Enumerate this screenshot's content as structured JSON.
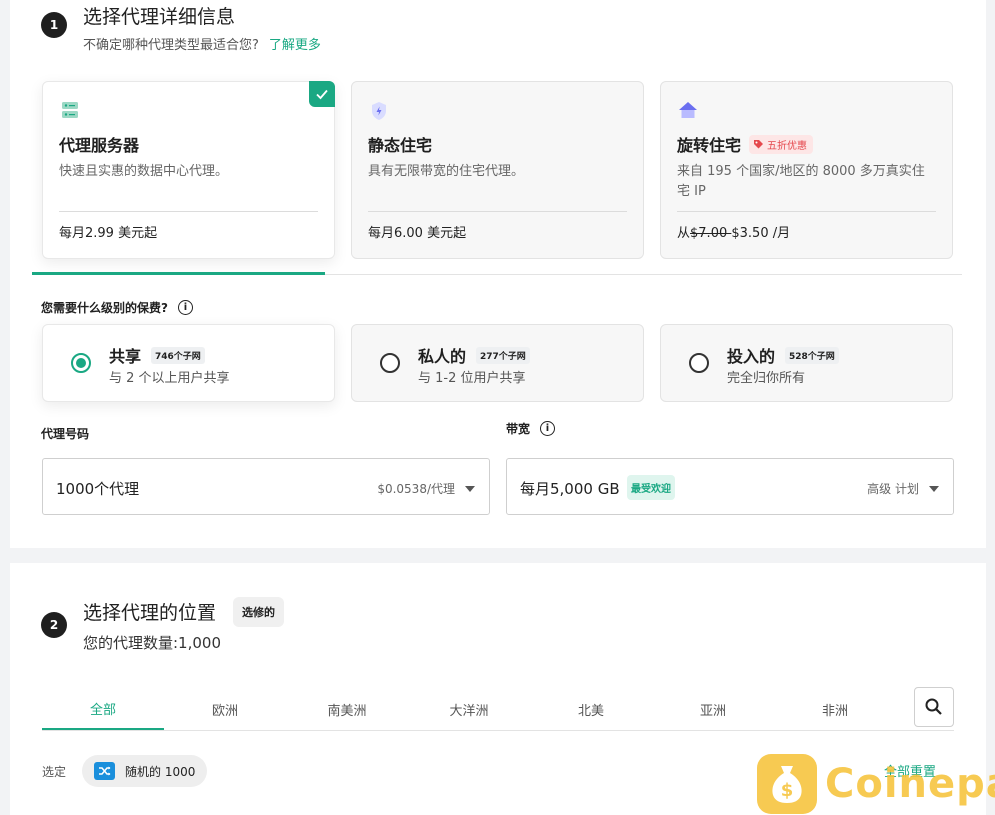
{
  "step1": {
    "number": "1",
    "title": "选择代理详细信息",
    "subtitle": "不确定哪种代理类型最适合您?",
    "learn_more": "了解更多"
  },
  "proxy_types": [
    {
      "name": "代理服务器",
      "desc": "快速且实惠的数据中心代理。",
      "price": "每月2.99 美元起",
      "selected": true,
      "icon": "server-icon"
    },
    {
      "name": "静态住宅",
      "desc": "具有无限带宽的住宅代理。",
      "price": "每月6.00 美元起",
      "selected": false,
      "icon": "shield-icon"
    },
    {
      "name": "旋转住宅",
      "badge": "五折优惠",
      "desc": "来自 195 个国家/地区的 8000 多万真实住宅 IP",
      "price_prefix": "从",
      "price_old": "$7.00 ",
      "price_new": " $3.50 /月",
      "selected": false,
      "icon": "house-icon"
    }
  ],
  "privacy_question": "您需要什么级别的保费?",
  "tiers": [
    {
      "name": "共享",
      "count": "746个子网",
      "desc": "与 2 个以上用户共享",
      "selected": true
    },
    {
      "name": "私人的",
      "count": "277个子网",
      "desc": "与 1-2 位用户共享",
      "selected": false
    },
    {
      "name": "投入的",
      "count": "528个子网",
      "desc": "完全归你所有",
      "selected": false
    }
  ],
  "proxy_count": {
    "label": "代理号码",
    "value": "1000个代理",
    "unit_price": "$0.0538/代理"
  },
  "bandwidth": {
    "label": "带宽",
    "value": "每月5,000 GB",
    "badge": "最受欢迎",
    "plan": "高级 计划"
  },
  "step2": {
    "number": "2",
    "title": "选择代理的位置",
    "optional": "选修的",
    "subtitle": "您的代理数量:1,000"
  },
  "regions": [
    "全部",
    "欧洲",
    "南美洲",
    "大洋洲",
    "北美",
    "亚洲",
    "非洲"
  ],
  "active_region": "全部",
  "selected_label": "选定",
  "selected_chip": "随机的 1000",
  "reset_all": "全部重置",
  "watermark": "Coinepay",
  "colors": {
    "accent": "#1aa883",
    "sale": "#e5484d",
    "watermark": "#f6c33b"
  }
}
